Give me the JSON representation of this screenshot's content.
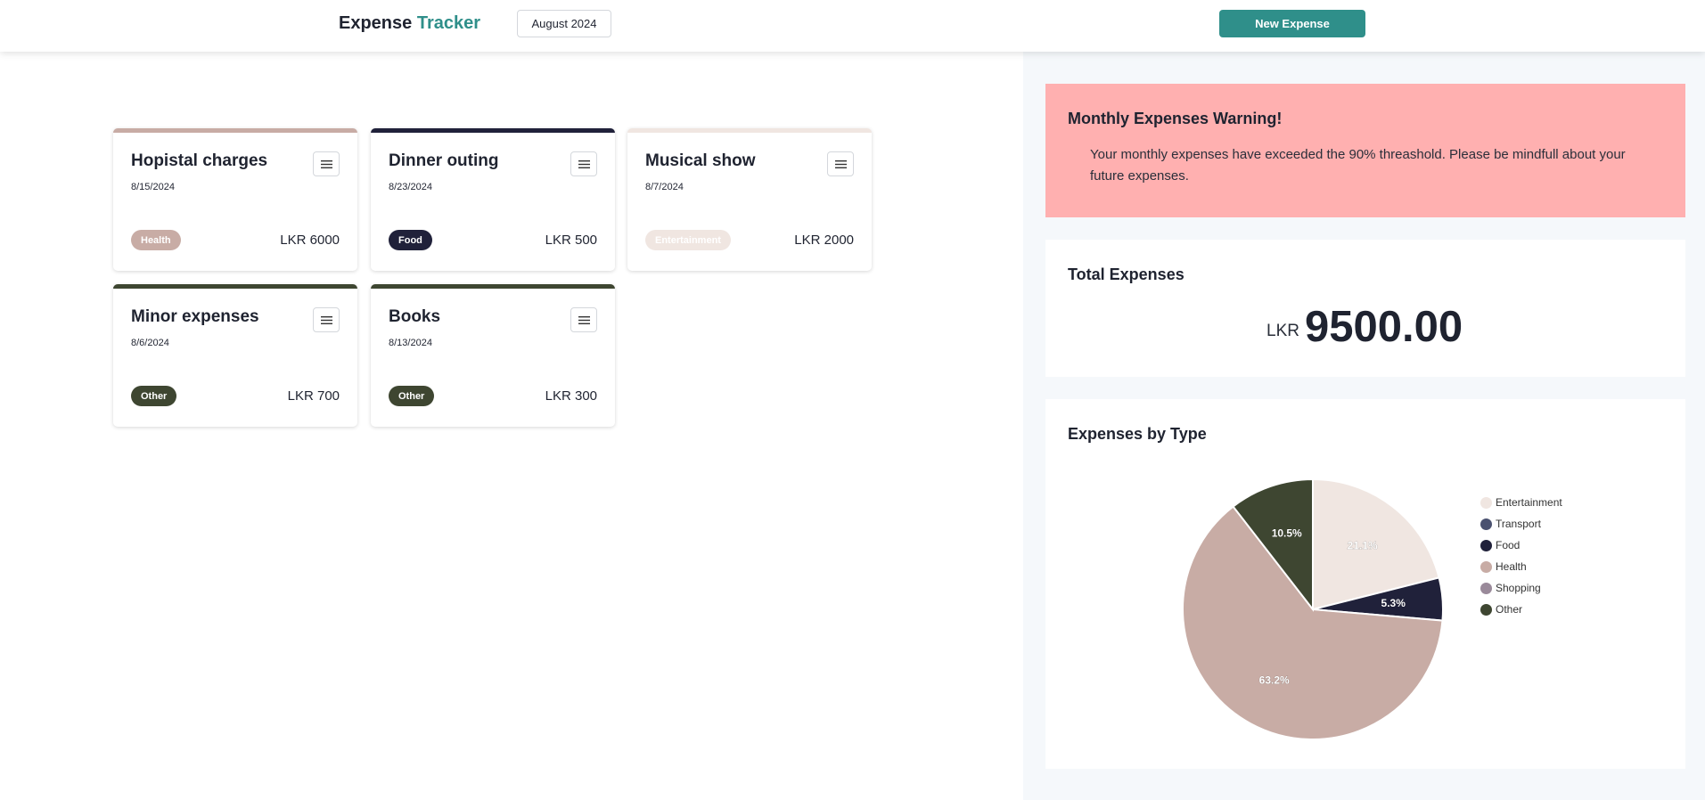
{
  "header": {
    "brand_part1": "Expense",
    "brand_part2": "Tracker",
    "month": "August 2024",
    "new_expense": "New Expense"
  },
  "colors": {
    "accent": "#2f8f8a",
    "Entertainment": "#f0e6e1",
    "Transport": "#4a5170",
    "Food": "#20213a",
    "Health": "#c8aca5",
    "Shopping": "#9a8a9a",
    "Other": "#3e4631"
  },
  "expenses": [
    {
      "title": "Hopistal charges",
      "date": "8/15/2024",
      "tag": "Health",
      "amount": "LKR 6000"
    },
    {
      "title": "Dinner outing",
      "date": "8/23/2024",
      "tag": "Food",
      "amount": "LKR 500"
    },
    {
      "title": "Musical show",
      "date": "8/7/2024",
      "tag": "Entertainment",
      "amount": "LKR 2000"
    },
    {
      "title": "Minor expenses",
      "date": "8/6/2024",
      "tag": "Other",
      "amount": "LKR 700"
    },
    {
      "title": "Books",
      "date": "8/13/2024",
      "tag": "Other",
      "amount": "LKR 300"
    }
  ],
  "warning": {
    "title": "Monthly Expenses Warning!",
    "text": "Your monthly expenses have exceeded the 90% threashold. Please be mindfull about your future expenses."
  },
  "total": {
    "title": "Total Expenses",
    "currency": "LKR",
    "value": "9500.00"
  },
  "by_type": {
    "title": "Expenses by Type"
  },
  "chart_data": {
    "type": "pie",
    "categories": [
      "Entertainment",
      "Transport",
      "Food",
      "Health",
      "Shopping",
      "Other"
    ],
    "values": [
      21.1,
      0,
      5.3,
      63.2,
      0,
      10.5
    ],
    "labels": [
      "21.1%",
      "",
      "5.3%",
      "63.2%",
      "",
      "10.5%"
    ],
    "legend_position": "right"
  }
}
